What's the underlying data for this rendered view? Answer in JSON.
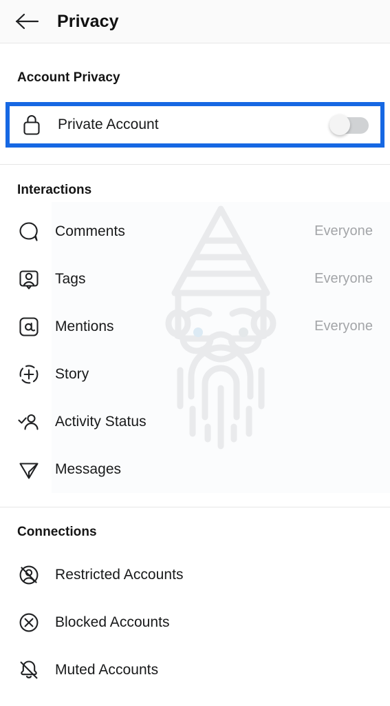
{
  "header": {
    "back_icon": "arrow-left-icon",
    "title": "Privacy"
  },
  "sections": {
    "account_privacy": {
      "title": "Account Privacy",
      "row": {
        "icon": "lock-icon",
        "label": "Private Account",
        "toggle_state": "off"
      },
      "highlight_color": "#1668e3"
    },
    "interactions": {
      "title": "Interactions",
      "items": [
        {
          "icon": "comment-bubble-icon",
          "label": "Comments",
          "value": "Everyone"
        },
        {
          "icon": "tag-person-icon",
          "label": "Tags",
          "value": "Everyone"
        },
        {
          "icon": "at-mention-icon",
          "label": "Mentions",
          "value": "Everyone"
        },
        {
          "icon": "story-plus-icon",
          "label": "Story",
          "value": ""
        },
        {
          "icon": "activity-status-icon",
          "label": "Activity Status",
          "value": ""
        },
        {
          "icon": "paper-plane-icon",
          "label": "Messages",
          "value": ""
        }
      ]
    },
    "connections": {
      "title": "Connections",
      "items": [
        {
          "icon": "restricted-account-icon",
          "label": "Restricted Accounts",
          "value": ""
        },
        {
          "icon": "blocked-account-icon",
          "label": "Blocked Accounts",
          "value": ""
        },
        {
          "icon": "muted-account-icon",
          "label": "Muted Accounts",
          "value": ""
        }
      ]
    }
  },
  "watermark": {
    "name": "gnome-illustration-watermark"
  },
  "colors": {
    "accent_blue": "#1668e3",
    "value_gray": "#a3a5a8",
    "header_bg": "#fafafa",
    "icon_dark": "#1f2022",
    "watermark_gray": "#e9eaec"
  }
}
